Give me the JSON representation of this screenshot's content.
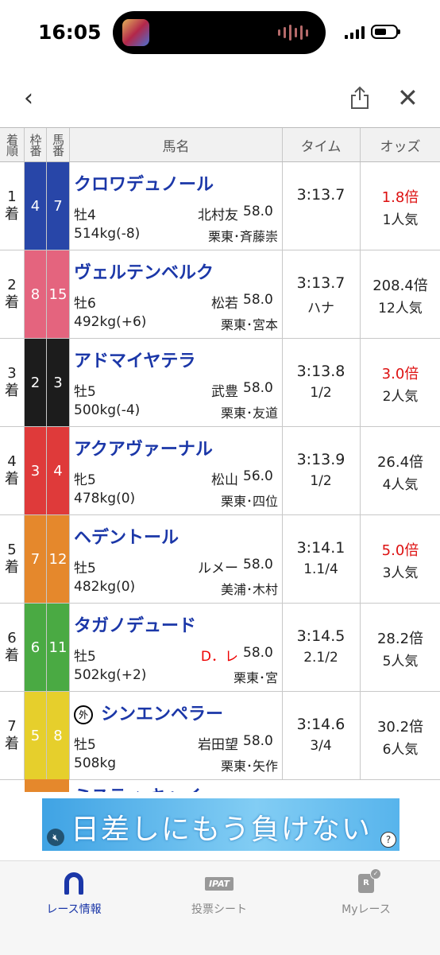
{
  "status": {
    "time": "16:05"
  },
  "header": {
    "col_rank": "着順",
    "col_waku": "枠番",
    "col_uma": "馬番",
    "col_name": "馬名",
    "col_time": "タイム",
    "col_odds": "オッズ"
  },
  "rows": [
    {
      "rank_num": "1",
      "rank_unit": "着",
      "waku": "4",
      "uma": "7",
      "waku_color": "#2846a8",
      "waku_text": "#ffffff",
      "name": "クロワデュノール",
      "sexage": "牡4",
      "jockey": "北村友",
      "wkg": "58.0",
      "weight": "514kg(-8)",
      "trainer": "栗東･斉藤崇",
      "time": "3:13.7",
      "margin": "",
      "odds": "1.8倍",
      "odds_red": true,
      "pop": "1人気",
      "jockey_red": false,
      "gai": false
    },
    {
      "rank_num": "2",
      "rank_unit": "着",
      "waku": "8",
      "uma": "15",
      "waku_color": "#e4647e",
      "waku_text": "#ffffff",
      "name": "ヴェルテンベルク",
      "sexage": "牡6",
      "jockey": "松若",
      "wkg": "58.0",
      "weight": "492kg(+6)",
      "trainer": "栗東･宮本",
      "time": "3:13.7",
      "margin": "ハナ",
      "odds": "208.4倍",
      "odds_red": false,
      "pop": "12人気",
      "jockey_red": false,
      "gai": false
    },
    {
      "rank_num": "3",
      "rank_unit": "着",
      "waku": "2",
      "uma": "3",
      "waku_color": "#1c1c1c",
      "waku_text": "#ffffff",
      "name": "アドマイヤテラ",
      "sexage": "牡5",
      "jockey": "武豊",
      "wkg": "58.0",
      "weight": "500kg(-4)",
      "trainer": "栗東･友道",
      "time": "3:13.8",
      "margin": "1/2",
      "odds": "3.0倍",
      "odds_red": true,
      "pop": "2人気",
      "jockey_red": false,
      "gai": false
    },
    {
      "rank_num": "4",
      "rank_unit": "着",
      "waku": "3",
      "uma": "4",
      "waku_color": "#df3a3a",
      "waku_text": "#ffffff",
      "name": "アクアヴァーナル",
      "sexage": "牝5",
      "jockey": "松山",
      "wkg": "56.0",
      "weight": "478kg(0)",
      "trainer": "栗東･四位",
      "time": "3:13.9",
      "margin": "1/2",
      "odds": "26.4倍",
      "odds_red": false,
      "pop": "4人気",
      "jockey_red": false,
      "gai": false
    },
    {
      "rank_num": "5",
      "rank_unit": "着",
      "waku": "7",
      "uma": "12",
      "waku_color": "#e5882c",
      "waku_text": "#ffffff",
      "name": "ヘデントール",
      "sexage": "牡5",
      "jockey": "ルメー",
      "wkg": "58.0",
      "weight": "482kg(0)",
      "trainer": "美浦･木村",
      "time": "3:14.1",
      "margin": "1.1/4",
      "odds": "5.0倍",
      "odds_red": true,
      "pop": "3人気",
      "jockey_red": false,
      "gai": false
    },
    {
      "rank_num": "6",
      "rank_unit": "着",
      "waku": "6",
      "uma": "11",
      "waku_color": "#4aaa43",
      "waku_text": "#ffffff",
      "name": "タガノデュード",
      "sexage": "牡5",
      "jockey": "D．レ",
      "wkg": "58.0",
      "weight": "502kg(+2)",
      "trainer": "栗東･宮",
      "time": "3:14.5",
      "margin": "2.1/2",
      "odds": "28.2倍",
      "odds_red": false,
      "pop": "5人気",
      "jockey_red": true,
      "gai": false
    },
    {
      "rank_num": "7",
      "rank_unit": "着",
      "waku": "5",
      "uma": "8",
      "waku_color": "#e6cf2c",
      "waku_text": "#ffffff",
      "name": "シンエンペラー",
      "gai_label": "外",
      "sexage": "牡5",
      "jockey": "岩田望",
      "wkg": "58.0",
      "weight": "508kg",
      "trainer": "栗東･矢作",
      "time": "3:14.6",
      "margin": "3/4",
      "odds": "30.2倍",
      "odds_red": false,
      "pop": "6人気",
      "jockey_red": false,
      "gai": true
    }
  ],
  "partial_row": {
    "name": "ミスティ キャイ"
  },
  "ad": {
    "text": "日差しにもう負けない",
    "help": "?"
  },
  "tabbar": [
    {
      "label": "レース情報",
      "icon": "horseshoe-icon",
      "active": true
    },
    {
      "label": "投票シート",
      "icon": "ipat-icon",
      "icon_text": "IPAT",
      "active": false
    },
    {
      "label": "Myレース",
      "icon": "my-race-icon",
      "icon_text": "R",
      "active": false
    }
  ]
}
